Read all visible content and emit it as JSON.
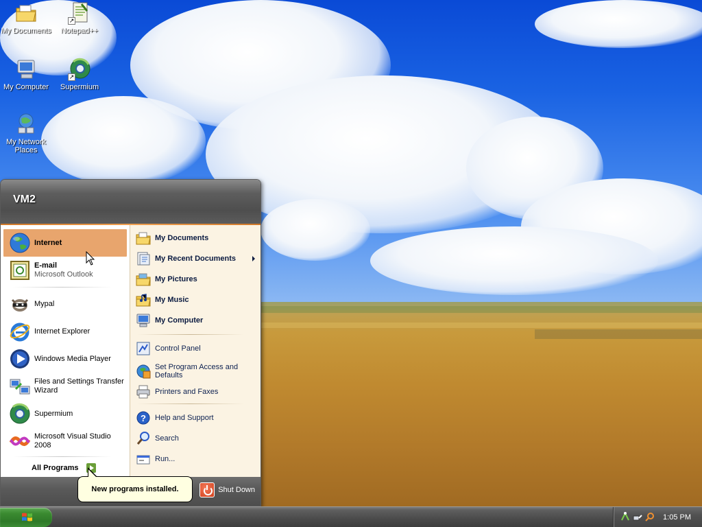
{
  "desktop": {
    "icons": [
      {
        "label": "My Documents",
        "icon": "my-documents-icon"
      },
      {
        "label": "Notepad++",
        "icon": "notepad-plus-plus-icon"
      },
      {
        "label": "My Computer",
        "icon": "my-computer-icon"
      },
      {
        "label": "Supermium",
        "icon": "supermium-icon"
      },
      {
        "label": "My Network Places",
        "icon": "network-places-icon"
      }
    ]
  },
  "start_menu": {
    "user_name": "VM2",
    "pinned": [
      {
        "label": "Internet",
        "icon": "internet-globe-icon",
        "highlighted": true
      },
      {
        "label": "E-mail",
        "sub": "Microsoft Outlook",
        "icon": "outlook-icon"
      }
    ],
    "recent": [
      {
        "label": "Mypal",
        "icon": "mypal-icon"
      },
      {
        "label": "Internet Explorer",
        "icon": "internet-explorer-icon"
      },
      {
        "label": "Windows Media Player",
        "icon": "media-player-icon"
      },
      {
        "label": "Files and Settings Transfer Wizard",
        "icon": "transfer-wizard-icon"
      },
      {
        "label": "Supermium",
        "icon": "supermium-icon"
      },
      {
        "label": "Microsoft Visual Studio 2008",
        "icon": "visual-studio-icon"
      }
    ],
    "all_programs": "All Programs",
    "right_column": [
      {
        "label": "My Documents",
        "icon": "folder-icon"
      },
      {
        "label": "My Recent Documents",
        "icon": "recent-docs-icon",
        "submenu": true
      },
      {
        "label": "My Pictures",
        "icon": "pictures-folder-icon"
      },
      {
        "label": "My Music",
        "icon": "music-folder-icon"
      },
      {
        "label": "My Computer",
        "icon": "computer-icon"
      },
      {
        "label": "Control Panel",
        "icon": "control-panel-icon"
      },
      {
        "label": "Set Program Access and Defaults",
        "icon": "program-access-icon"
      },
      {
        "label": "Printers and Faxes",
        "icon": "printer-icon"
      },
      {
        "label": "Help and Support",
        "icon": "help-icon"
      },
      {
        "label": "Search",
        "icon": "search-icon"
      },
      {
        "label": "Run...",
        "icon": "run-icon"
      }
    ],
    "shutdown_label": "Shut Down"
  },
  "balloon": {
    "text": "New programs installed."
  },
  "taskbar": {
    "clock": "1:05 PM",
    "tray_icons": [
      "network-icon",
      "connection-icon",
      "search-tray-icon"
    ]
  },
  "colors": {
    "highlight": "#e8a56d",
    "taskbar": "#4a4a4a",
    "start_button": "#3a8a30",
    "menu_right_bg": "#fbf3e3"
  }
}
